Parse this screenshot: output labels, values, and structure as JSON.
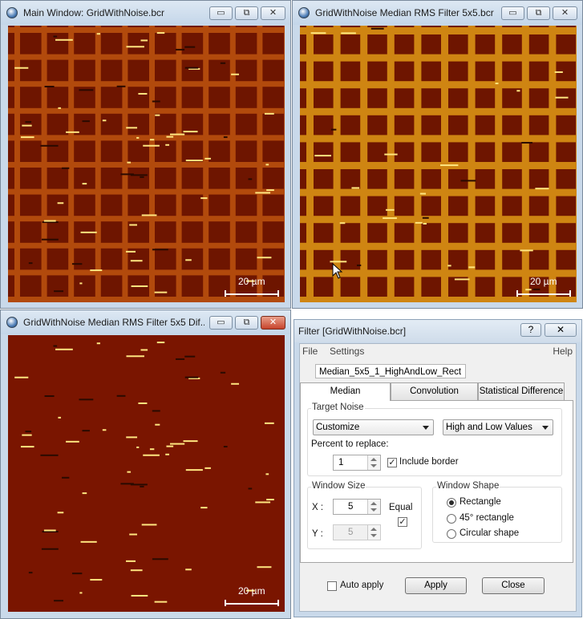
{
  "windows": {
    "main": {
      "title": "Main Window: GridWithNoise.bcr",
      "scale": "20 µm"
    },
    "filtered": {
      "title": "GridWithNoise Median RMS Filter 5x5.bcr",
      "scale": "20 µm"
    },
    "difference": {
      "title": "GridWithNoise Median RMS Filter 5x5 Dif...",
      "scale": "20 µm"
    }
  },
  "window_buttons": {
    "minimize": "▭",
    "maximize": "⧉",
    "close": "✕"
  },
  "dialog": {
    "title": "Filter [GridWithNoise.bcr]",
    "help_label": "?",
    "close_label": "✕",
    "menu": {
      "file": "File",
      "settings": "Settings",
      "help": "Help"
    },
    "preset_name": "Median_5x5_1_HighAndLow_Rect",
    "tabs": [
      "Median",
      "Convolution",
      "Statistical Difference"
    ],
    "target_noise": {
      "label": "Target Noise",
      "mode": "Customize",
      "values": "High and Low Values",
      "percent_label": "Percent to replace:",
      "percent_value": "1",
      "include_border_label": "Include border",
      "include_border_checked": "✓"
    },
    "window_size": {
      "label": "Window Size",
      "x_label": "X :",
      "x_value": "5",
      "y_label": "Y :",
      "y_value": "5",
      "equal_label": "Equal",
      "equal_checked": "✓"
    },
    "window_shape": {
      "label": "Window Shape",
      "options": [
        "Rectangle",
        "45° rectangle",
        "Circular shape"
      ],
      "selected": "Rectangle"
    },
    "auto_apply_label": "Auto apply",
    "apply_label": "Apply",
    "close_button_label": "Close"
  },
  "colors": {
    "grid_dark": "#6e1500",
    "grid_line_main": "#b24a0c",
    "grid_line_filtered": "#cf8512",
    "difference_bg": "#7a1500",
    "highlight": "#ffe680"
  }
}
